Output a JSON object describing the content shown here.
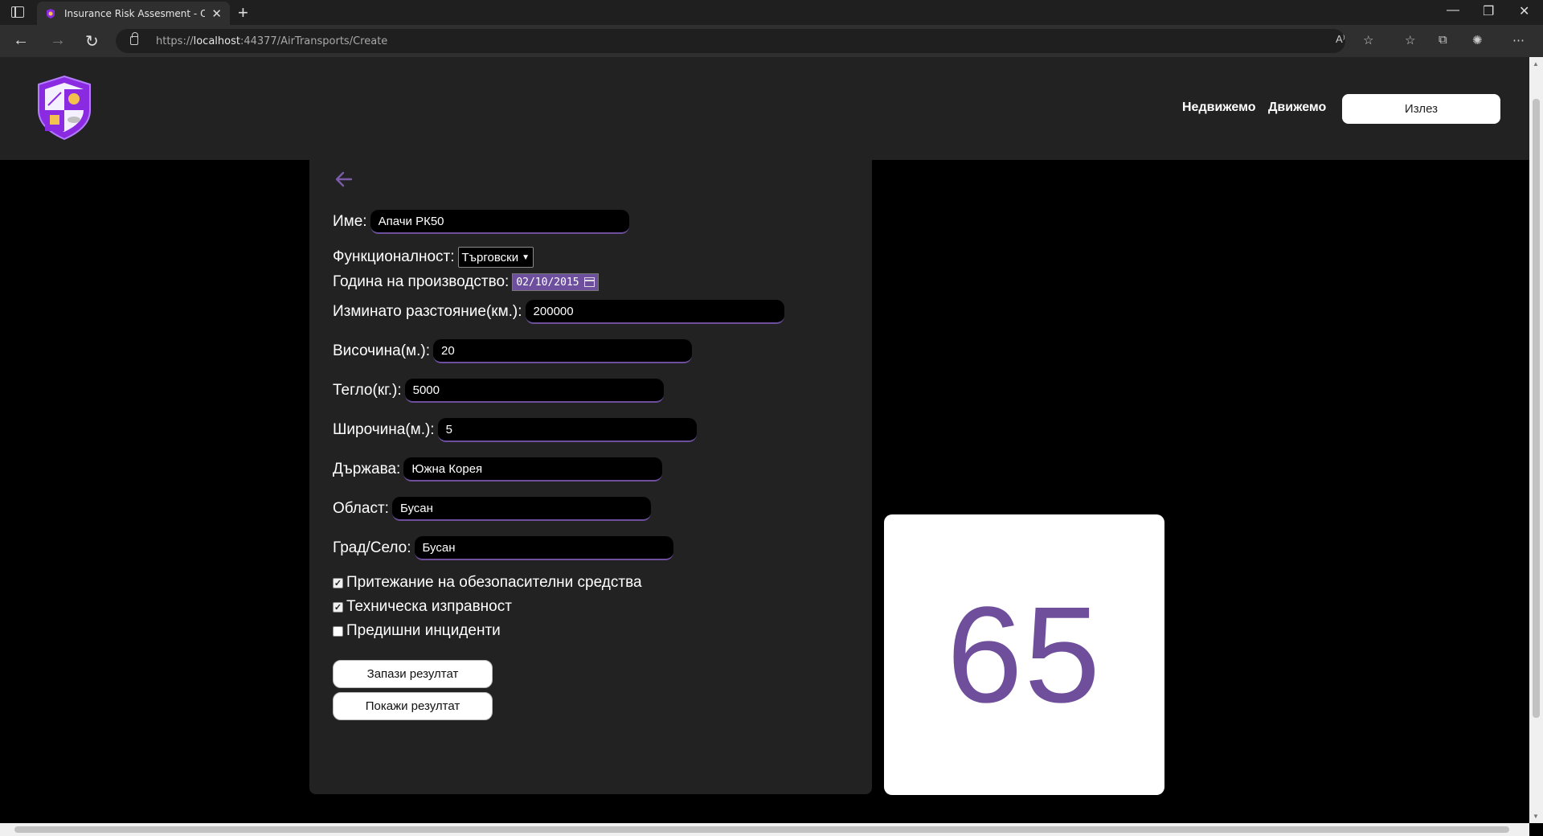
{
  "browser": {
    "tab_title": "Insurance Risk Assesment - Оце",
    "url_prefix": "https://",
    "url_host": "localhost",
    "url_rest": ":44377/AirTransports/Create"
  },
  "header": {
    "nav": [
      "Недвижемо",
      "Движемо"
    ],
    "logout_label": "Излез"
  },
  "form": {
    "name_label": "Име:",
    "name_value": "Апачи РК50",
    "functionality_label": "Функционалност:",
    "functionality_value": "Търговски",
    "year_label": "Година на производство:",
    "year_value": "02/10/2015",
    "distance_label": "Изминато разстояние(км.):",
    "distance_value": "200000",
    "height_label": "Височина(м.):",
    "height_value": "20",
    "weight_label": "Тегло(кг.):",
    "weight_value": "5000",
    "width_label": "Широчина(м.):",
    "width_value": "5",
    "country_label": "Държава:",
    "country_value": "Южна Корея",
    "region_label": "Област:",
    "region_value": "Бусан",
    "city_label": "Град/Село:",
    "city_value": "Бусан",
    "checks": [
      {
        "label": "Притежание на обезопасителни средства",
        "checked": true
      },
      {
        "label": "Техническа изправност",
        "checked": true
      },
      {
        "label": "Предишни инциденти",
        "checked": false
      }
    ],
    "save_label": "Запази резултат",
    "show_label": "Покажи резултат"
  },
  "result": {
    "score": "65"
  },
  "colors": {
    "accent": "#6f4f9c",
    "panel": "#222223",
    "background": "#000000"
  }
}
